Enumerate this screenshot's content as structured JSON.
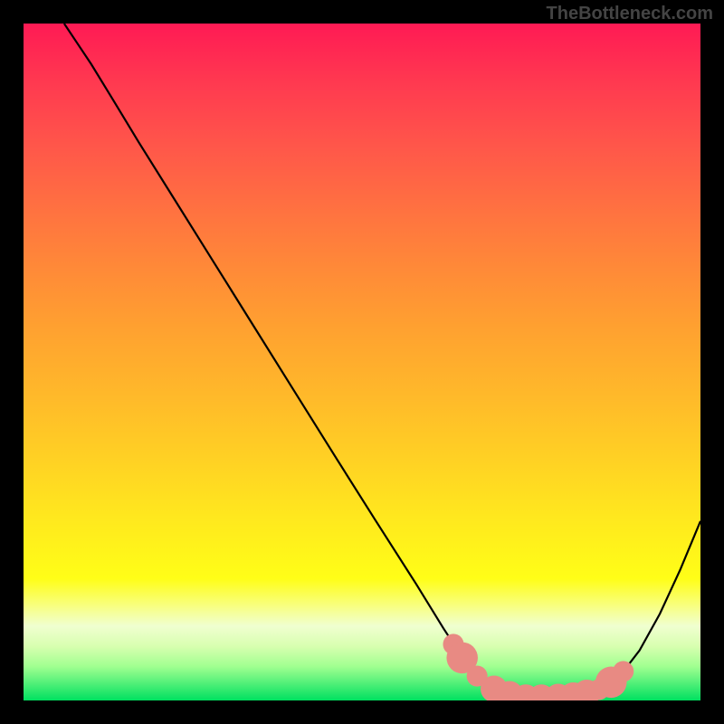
{
  "attribution": "TheBottleneck.com",
  "chart_data": {
    "type": "line",
    "title": "",
    "xlabel": "",
    "ylabel": "",
    "xlim": [
      0,
      100
    ],
    "ylim": [
      0,
      100
    ],
    "curve": [
      {
        "x": 6,
        "y": 100
      },
      {
        "x": 8,
        "y": 97
      },
      {
        "x": 10,
        "y": 94
      },
      {
        "x": 13,
        "y": 89.1
      },
      {
        "x": 17,
        "y": 82.5
      },
      {
        "x": 22,
        "y": 74.5
      },
      {
        "x": 28,
        "y": 64.9
      },
      {
        "x": 34,
        "y": 55.3
      },
      {
        "x": 40,
        "y": 45.7
      },
      {
        "x": 46,
        "y": 36.1
      },
      {
        "x": 52,
        "y": 26.6
      },
      {
        "x": 58,
        "y": 17.2
      },
      {
        "x": 62,
        "y": 10.7
      },
      {
        "x": 65,
        "y": 6.1
      },
      {
        "x": 68,
        "y": 2.9
      },
      {
        "x": 71,
        "y": 1.1
      },
      {
        "x": 74,
        "y": 0.3
      },
      {
        "x": 78,
        "y": 0.3
      },
      {
        "x": 82,
        "y": 0.6
      },
      {
        "x": 85,
        "y": 1.5
      },
      {
        "x": 88,
        "y": 3.5
      },
      {
        "x": 91,
        "y": 7.4
      },
      {
        "x": 94,
        "y": 12.8
      },
      {
        "x": 97,
        "y": 19.3
      },
      {
        "x": 100,
        "y": 26.5
      }
    ],
    "markers": [
      {
        "x": 63.5,
        "y": 8.3,
        "r": 2.8
      },
      {
        "x": 64.8,
        "y": 6.3,
        "r": 4.2
      },
      {
        "x": 67.0,
        "y": 3.6,
        "r": 2.8
      },
      {
        "x": 69.5,
        "y": 1.7,
        "r": 3.6
      },
      {
        "x": 71.8,
        "y": 0.9,
        "r": 3.6
      },
      {
        "x": 74.2,
        "y": 0.4,
        "r": 3.6
      },
      {
        "x": 76.5,
        "y": 0.4,
        "r": 3.6
      },
      {
        "x": 79.0,
        "y": 0.5,
        "r": 3.6
      },
      {
        "x": 81.2,
        "y": 0.7,
        "r": 3.6
      },
      {
        "x": 83.2,
        "y": 1.1,
        "r": 3.6
      },
      {
        "x": 85.0,
        "y": 1.6,
        "r": 2.8
      },
      {
        "x": 86.8,
        "y": 2.7,
        "r": 4.2
      },
      {
        "x": 88.6,
        "y": 4.3,
        "r": 2.8
      }
    ],
    "gradient_stops": [
      {
        "pos": 0,
        "color": "#ff1a54"
      },
      {
        "pos": 9,
        "color": "#ff3a50"
      },
      {
        "pos": 18,
        "color": "#ff564a"
      },
      {
        "pos": 27,
        "color": "#ff7041"
      },
      {
        "pos": 36,
        "color": "#ff8938"
      },
      {
        "pos": 45,
        "color": "#ffa130"
      },
      {
        "pos": 55,
        "color": "#ffb92a"
      },
      {
        "pos": 64,
        "color": "#ffd024"
      },
      {
        "pos": 73,
        "color": "#ffe81e"
      },
      {
        "pos": 82,
        "color": "#fffe17"
      },
      {
        "pos": 86,
        "color": "#f8ff80"
      },
      {
        "pos": 89,
        "color": "#f0ffd0"
      },
      {
        "pos": 92,
        "color": "#d8ffb0"
      },
      {
        "pos": 95,
        "color": "#a0ff90"
      },
      {
        "pos": 100,
        "color": "#00e060"
      }
    ]
  }
}
